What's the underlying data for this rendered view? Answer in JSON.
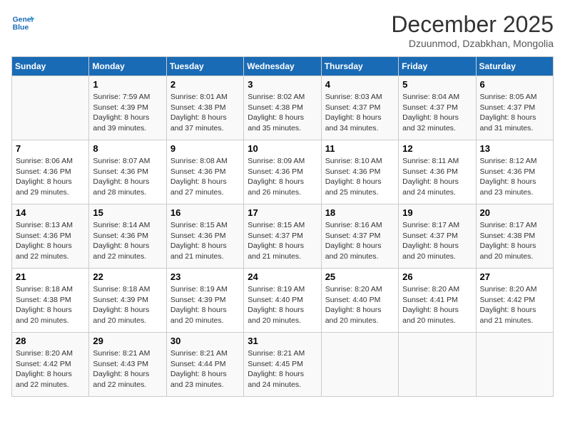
{
  "header": {
    "logo_line1": "General",
    "logo_line2": "Blue",
    "month": "December 2025",
    "location": "Dzuunmod, Dzabkhan, Mongolia"
  },
  "days_of_week": [
    "Sunday",
    "Monday",
    "Tuesday",
    "Wednesday",
    "Thursday",
    "Friday",
    "Saturday"
  ],
  "weeks": [
    [
      {
        "day": "",
        "detail": ""
      },
      {
        "day": "1",
        "detail": "Sunrise: 7:59 AM\nSunset: 4:39 PM\nDaylight: 8 hours\nand 39 minutes."
      },
      {
        "day": "2",
        "detail": "Sunrise: 8:01 AM\nSunset: 4:38 PM\nDaylight: 8 hours\nand 37 minutes."
      },
      {
        "day": "3",
        "detail": "Sunrise: 8:02 AM\nSunset: 4:38 PM\nDaylight: 8 hours\nand 35 minutes."
      },
      {
        "day": "4",
        "detail": "Sunrise: 8:03 AM\nSunset: 4:37 PM\nDaylight: 8 hours\nand 34 minutes."
      },
      {
        "day": "5",
        "detail": "Sunrise: 8:04 AM\nSunset: 4:37 PM\nDaylight: 8 hours\nand 32 minutes."
      },
      {
        "day": "6",
        "detail": "Sunrise: 8:05 AM\nSunset: 4:37 PM\nDaylight: 8 hours\nand 31 minutes."
      }
    ],
    [
      {
        "day": "7",
        "detail": "Sunrise: 8:06 AM\nSunset: 4:36 PM\nDaylight: 8 hours\nand 29 minutes."
      },
      {
        "day": "8",
        "detail": "Sunrise: 8:07 AM\nSunset: 4:36 PM\nDaylight: 8 hours\nand 28 minutes."
      },
      {
        "day": "9",
        "detail": "Sunrise: 8:08 AM\nSunset: 4:36 PM\nDaylight: 8 hours\nand 27 minutes."
      },
      {
        "day": "10",
        "detail": "Sunrise: 8:09 AM\nSunset: 4:36 PM\nDaylight: 8 hours\nand 26 minutes."
      },
      {
        "day": "11",
        "detail": "Sunrise: 8:10 AM\nSunset: 4:36 PM\nDaylight: 8 hours\nand 25 minutes."
      },
      {
        "day": "12",
        "detail": "Sunrise: 8:11 AM\nSunset: 4:36 PM\nDaylight: 8 hours\nand 24 minutes."
      },
      {
        "day": "13",
        "detail": "Sunrise: 8:12 AM\nSunset: 4:36 PM\nDaylight: 8 hours\nand 23 minutes."
      }
    ],
    [
      {
        "day": "14",
        "detail": "Sunrise: 8:13 AM\nSunset: 4:36 PM\nDaylight: 8 hours\nand 22 minutes."
      },
      {
        "day": "15",
        "detail": "Sunrise: 8:14 AM\nSunset: 4:36 PM\nDaylight: 8 hours\nand 22 minutes."
      },
      {
        "day": "16",
        "detail": "Sunrise: 8:15 AM\nSunset: 4:36 PM\nDaylight: 8 hours\nand 21 minutes."
      },
      {
        "day": "17",
        "detail": "Sunrise: 8:15 AM\nSunset: 4:37 PM\nDaylight: 8 hours\nand 21 minutes."
      },
      {
        "day": "18",
        "detail": "Sunrise: 8:16 AM\nSunset: 4:37 PM\nDaylight: 8 hours\nand 20 minutes."
      },
      {
        "day": "19",
        "detail": "Sunrise: 8:17 AM\nSunset: 4:37 PM\nDaylight: 8 hours\nand 20 minutes."
      },
      {
        "day": "20",
        "detail": "Sunrise: 8:17 AM\nSunset: 4:38 PM\nDaylight: 8 hours\nand 20 minutes."
      }
    ],
    [
      {
        "day": "21",
        "detail": "Sunrise: 8:18 AM\nSunset: 4:38 PM\nDaylight: 8 hours\nand 20 minutes."
      },
      {
        "day": "22",
        "detail": "Sunrise: 8:18 AM\nSunset: 4:39 PM\nDaylight: 8 hours\nand 20 minutes."
      },
      {
        "day": "23",
        "detail": "Sunrise: 8:19 AM\nSunset: 4:39 PM\nDaylight: 8 hours\nand 20 minutes."
      },
      {
        "day": "24",
        "detail": "Sunrise: 8:19 AM\nSunset: 4:40 PM\nDaylight: 8 hours\nand 20 minutes."
      },
      {
        "day": "25",
        "detail": "Sunrise: 8:20 AM\nSunset: 4:40 PM\nDaylight: 8 hours\nand 20 minutes."
      },
      {
        "day": "26",
        "detail": "Sunrise: 8:20 AM\nSunset: 4:41 PM\nDaylight: 8 hours\nand 20 minutes."
      },
      {
        "day": "27",
        "detail": "Sunrise: 8:20 AM\nSunset: 4:42 PM\nDaylight: 8 hours\nand 21 minutes."
      }
    ],
    [
      {
        "day": "28",
        "detail": "Sunrise: 8:20 AM\nSunset: 4:42 PM\nDaylight: 8 hours\nand 22 minutes."
      },
      {
        "day": "29",
        "detail": "Sunrise: 8:21 AM\nSunset: 4:43 PM\nDaylight: 8 hours\nand 22 minutes."
      },
      {
        "day": "30",
        "detail": "Sunrise: 8:21 AM\nSunset: 4:44 PM\nDaylight: 8 hours\nand 23 minutes."
      },
      {
        "day": "31",
        "detail": "Sunrise: 8:21 AM\nSunset: 4:45 PM\nDaylight: 8 hours\nand 24 minutes."
      },
      {
        "day": "",
        "detail": ""
      },
      {
        "day": "",
        "detail": ""
      },
      {
        "day": "",
        "detail": ""
      }
    ]
  ]
}
